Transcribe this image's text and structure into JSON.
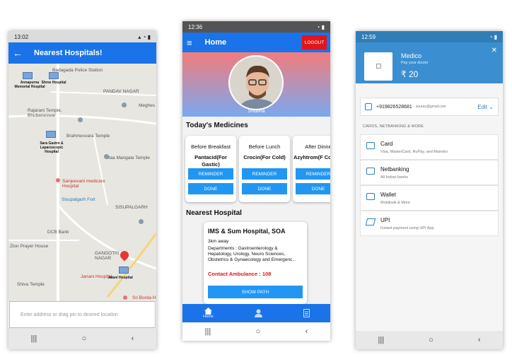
{
  "phone1": {
    "status_time": "13:02",
    "title": "Nearest Hospitals!",
    "map": {
      "streets": [
        "Badagada Police Station",
        "PANDAV NAGAR",
        "Meghes",
        "Rajarani Temple, Bhubaneswar",
        "Brahmesvara Temple",
        "Maa Mangala Temple",
        "Sanjeevani medicare Hospital",
        "Sisupalgarh Fort",
        "SISUPALGARH",
        "DCB Bank",
        "Zion Prayer House",
        "GANGOTRI NAGAR",
        "Janani Hospital",
        "Shiva Temple",
        "Sri Borda H"
      ],
      "hospitals": [
        "Annapurna Memorial Hospital",
        "Shree Hospital",
        "Sara Gastro & Laparoscopic Hospital",
        "Jatani Hospital"
      ]
    },
    "address_placeholder": "Enter address or drag pin to desired location"
  },
  "phone2": {
    "status_time": "12:36",
    "title": "Home",
    "logout_label": "LOGOUT",
    "username": "Shubha",
    "medicines_title": "Today's Medicines",
    "medicines": [
      {
        "time": "Before Breakfast",
        "name": "Pantacid(For Gastic)",
        "reminder": "REMINDER",
        "done": "DONE"
      },
      {
        "time": "Before Lunch",
        "name": "Crocin(For Cold)",
        "reminder": "REMINDER",
        "done": "DONE"
      },
      {
        "time": "After Dinne",
        "name": "Azyhtrom(F Cough)",
        "reminder": "REMINDER",
        "done": "DONE"
      }
    ],
    "hospital_title": "Nearest Hospital",
    "hospital": {
      "name": "IMS & Sum Hospital, SOA",
      "distance": "3km away",
      "departments": "Departments : Gastroenterology & Hepatology, Urology, Neuro Sciences, Obstetrics & Gynaecology and Emergenc...",
      "ambulance": "Contact Ambulance : 108",
      "button": "SHOW PATH"
    },
    "bottom_tabs": [
      {
        "icon": "home-icon",
        "label": "Home"
      },
      {
        "icon": "user-icon",
        "label": ""
      },
      {
        "icon": "document-icon",
        "label": ""
      }
    ]
  },
  "phone3": {
    "status_time": "12:59",
    "merchant": "Medico",
    "subtitle": "Pay your doctor",
    "amount": "₹ 20",
    "phone": "+919826528681",
    "email": "sourav@gmail.com",
    "edit_label": "Edit",
    "category_label": "CARDS, NETBANKING & MORE",
    "methods": [
      {
        "title": "Card",
        "desc": "Visa, MasterCard, RuPay, and Maestro",
        "icon": "card-icon"
      },
      {
        "title": "Netbanking",
        "desc": "All Indian banks",
        "icon": "bank-icon"
      },
      {
        "title": "Wallet",
        "desc": "Mobikwik & More",
        "icon": "wallet-icon"
      },
      {
        "title": "UPI",
        "desc": "Instant payment using UPI App",
        "icon": "upi-icon"
      }
    ]
  },
  "colors": {
    "primary_blue": "#1a73e8",
    "button_blue": "#2196f3",
    "logout_red": "#e0161b",
    "razorpay_blue": "#3b8fd0"
  }
}
